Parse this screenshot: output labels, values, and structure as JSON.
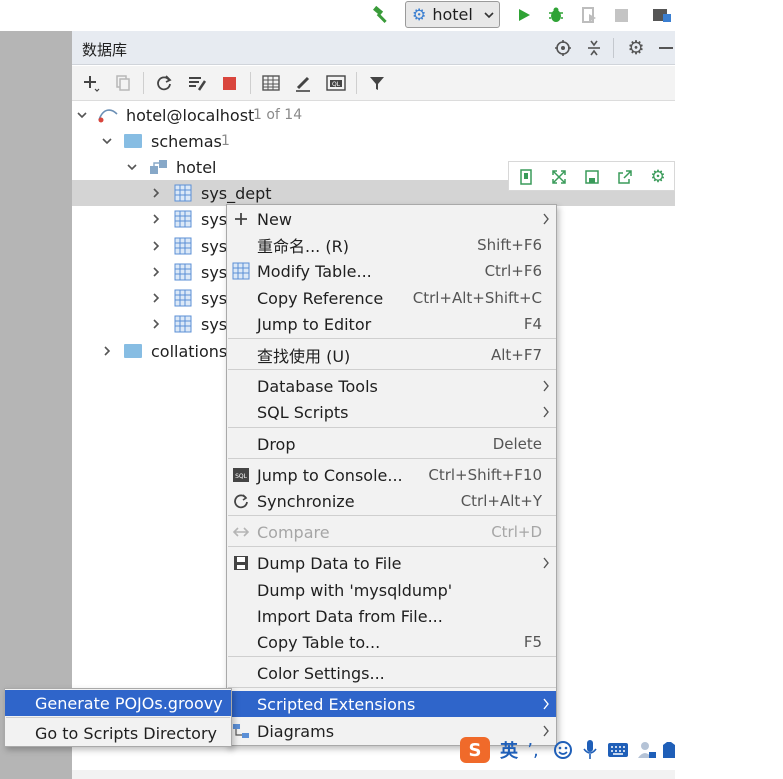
{
  "runbar": {
    "config_label": "hotel",
    "icons": [
      "build-hammer-icon",
      "config-gear-icon",
      "run-icon",
      "debug-bug-icon",
      "coverage-icon",
      "stop-icon",
      "project-structure-icon"
    ]
  },
  "panel": {
    "title": "数据库",
    "header_icons": [
      "target-icon",
      "collapse-icon",
      "settings-icon",
      "hide-icon"
    ],
    "toolbar_icons": [
      "add-icon",
      "copy-icon",
      "refresh-icon",
      "schema-tool-icon",
      "stop-icon",
      "table-icon",
      "edit-icon",
      "console-icon",
      "filter-icon"
    ]
  },
  "tree": {
    "host": {
      "label": "hotel@localhost",
      "count": "1 of 14"
    },
    "schemas": {
      "label": "schemas",
      "count": "1"
    },
    "schema": {
      "label": "hotel"
    },
    "tables": [
      "sys_dept",
      "sys_",
      "sys_",
      "sys_",
      "sys_",
      "sys_"
    ],
    "collations": {
      "label": "collations"
    }
  },
  "mini_toolbar": {
    "icons": [
      "pin-icon",
      "expand-icon",
      "save-icon",
      "export-icon",
      "gear-icon"
    ]
  },
  "context_menu": {
    "items": [
      {
        "label": "New",
        "shortcut": "",
        "submenu": true,
        "icon": "plus-icon"
      },
      {
        "label": "重命名... (R)",
        "shortcut": "Shift+F6",
        "submenu": false,
        "icon": ""
      },
      {
        "label": "Modify Table...",
        "shortcut": "Ctrl+F6",
        "submenu": false,
        "icon": "table-icon"
      },
      {
        "label": "Copy Reference",
        "shortcut": "Ctrl+Alt+Shift+C",
        "submenu": false,
        "icon": ""
      },
      {
        "label": "Jump to Editor",
        "shortcut": "F4",
        "submenu": false,
        "icon": ""
      },
      {
        "label": "查找使用 (U)",
        "shortcut": "Alt+F7",
        "submenu": false,
        "icon": ""
      },
      {
        "label": "Database Tools",
        "shortcut": "",
        "submenu": true,
        "icon": ""
      },
      {
        "label": "SQL Scripts",
        "shortcut": "",
        "submenu": true,
        "icon": ""
      },
      {
        "label": "Drop",
        "shortcut": "Delete",
        "submenu": false,
        "icon": ""
      },
      {
        "label": "Jump to Console...",
        "shortcut": "Ctrl+Shift+F10",
        "submenu": false,
        "icon": "console-icon"
      },
      {
        "label": "Synchronize",
        "shortcut": "Ctrl+Alt+Y",
        "submenu": false,
        "icon": "sync-icon"
      },
      {
        "label": "Compare",
        "shortcut": "Ctrl+D",
        "submenu": false,
        "icon": "compare-icon",
        "disabled": true
      },
      {
        "label": "Dump Data to File",
        "shortcut": "",
        "submenu": true,
        "icon": "dump-icon"
      },
      {
        "label": "Dump with 'mysqldump'",
        "shortcut": "",
        "submenu": false,
        "icon": ""
      },
      {
        "label": "Import Data from File...",
        "shortcut": "",
        "submenu": false,
        "icon": ""
      },
      {
        "label": "Copy Table to...",
        "shortcut": "F5",
        "submenu": false,
        "icon": ""
      },
      {
        "label": "Color Settings...",
        "shortcut": "",
        "submenu": false,
        "icon": ""
      },
      {
        "label": "Scripted Extensions",
        "shortcut": "",
        "submenu": true,
        "icon": "",
        "highlighted": true
      },
      {
        "label": "Diagrams",
        "shortcut": "",
        "submenu": true,
        "icon": "diagram-icon"
      }
    ]
  },
  "submenu": {
    "items": [
      {
        "label": "Generate POJOs.groovy",
        "highlighted": true
      },
      {
        "label": "Go to Scripts Directory",
        "highlighted": false
      }
    ]
  },
  "ime": {
    "lang_label": "英",
    "icons": [
      "sogou-logo-icon",
      "punctuation-icon",
      "emoji-icon",
      "mic-icon",
      "keyboard-icon",
      "user-icon",
      "skin-icon"
    ]
  },
  "colors": {
    "highlight": "#2f65ca",
    "table_icon": "#5b8fd6",
    "folder": "#87bde3",
    "run_green": "#2fa335",
    "stop_red": "#d9453d"
  }
}
